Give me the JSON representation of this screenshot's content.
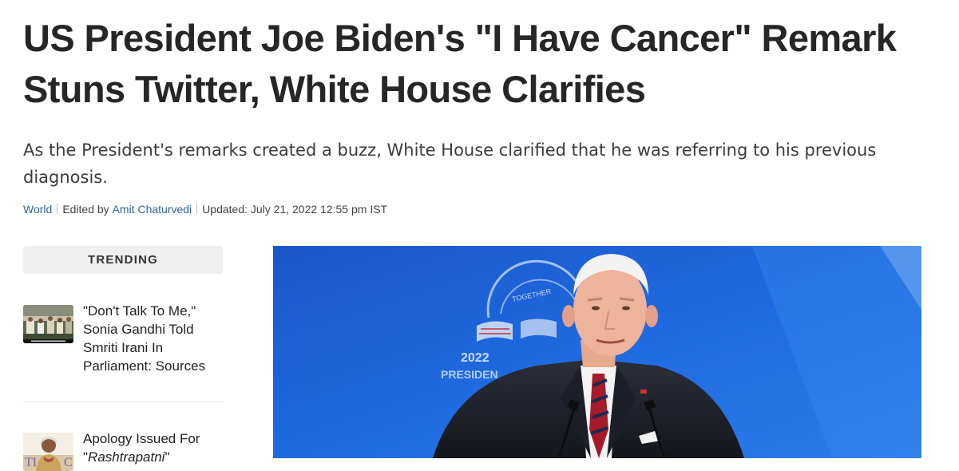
{
  "article": {
    "headline": "US President Joe Biden's \"I Have Cancer\" Remark Stuns Twitter, White House Clarifies",
    "subheadline": "As the President's remarks created a buzz, White House clarified that he was referring to his previous diagnosis.",
    "category": "World",
    "edited_by_prefix": "Edited by",
    "editor": "Amit Chaturvedi",
    "updated": "Updated: July 21, 2022 12:55 pm IST"
  },
  "sidebar": {
    "section_title": "TRENDING",
    "items": [
      {
        "title": "\"Don't Talk To Me,\" Sonia Gandhi Told Smriti Irani In Parliament: Sources"
      },
      {
        "title_part1": "Apology Issued For \"",
        "title_italic": "Rashtrapatni",
        "title_part2": "\""
      }
    ]
  },
  "hero_image": {
    "backdrop_text_1": "2022",
    "backdrop_text_2": "PRESIDEN",
    "backdrop_text_3": "TOGETHER"
  },
  "colors": {
    "headline": "#262626",
    "link": "#2f6397",
    "hero_bg": "#1e63d4"
  }
}
